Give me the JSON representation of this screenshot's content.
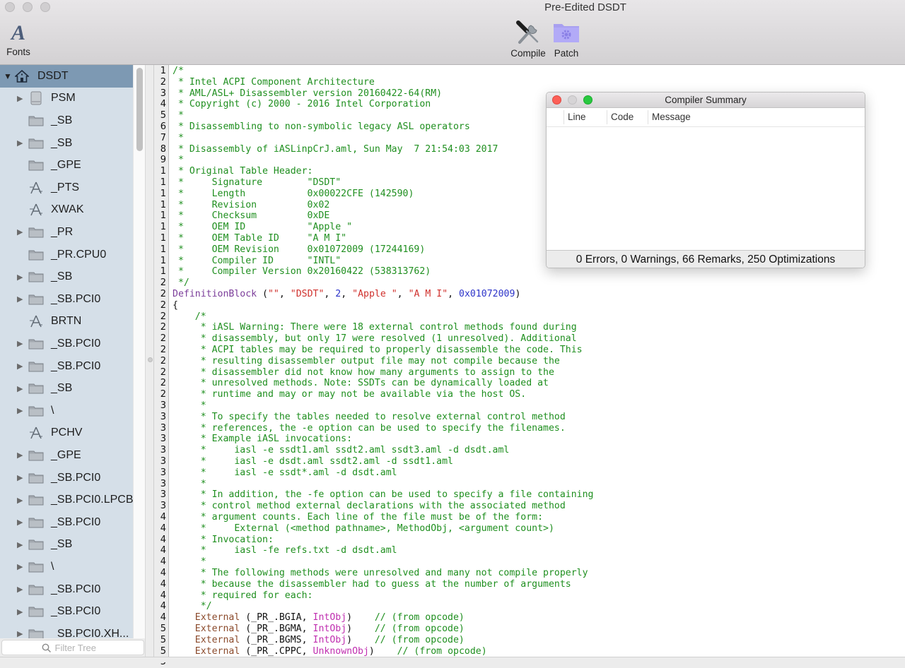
{
  "window": {
    "title": "Pre-Edited DSDT",
    "toolbar": {
      "fonts_label": "Fonts",
      "fonts_glyph": "A",
      "compile_label": "Compile",
      "patch_label": "Patch"
    }
  },
  "sidebar": {
    "root": {
      "label": "DSDT",
      "icon": "house-icon",
      "expanded": true
    },
    "items": [
      {
        "label": "PSM",
        "icon": "disk-icon",
        "expandable": true
      },
      {
        "label": "_SB",
        "icon": "folder-icon",
        "expandable": false
      },
      {
        "label": "_SB",
        "icon": "folder-icon",
        "expandable": true
      },
      {
        "label": "_GPE",
        "icon": "folder-icon",
        "expandable": false
      },
      {
        "label": "_PTS",
        "icon": "method-icon",
        "expandable": false
      },
      {
        "label": "XWAK",
        "icon": "method-icon",
        "expandable": false
      },
      {
        "label": "_PR",
        "icon": "folder-icon",
        "expandable": true
      },
      {
        "label": "_PR.CPU0",
        "icon": "folder-icon",
        "expandable": false
      },
      {
        "label": "_SB",
        "icon": "folder-icon",
        "expandable": true
      },
      {
        "label": "_SB.PCI0",
        "icon": "folder-icon",
        "expandable": true
      },
      {
        "label": "BRTN",
        "icon": "method-icon",
        "expandable": false
      },
      {
        "label": "_SB.PCI0",
        "icon": "folder-icon",
        "expandable": true
      },
      {
        "label": "_SB.PCI0",
        "icon": "folder-icon",
        "expandable": true
      },
      {
        "label": "_SB",
        "icon": "folder-icon",
        "expandable": true
      },
      {
        "label": "\\",
        "icon": "folder-icon",
        "expandable": true
      },
      {
        "label": "PCHV",
        "icon": "method-icon",
        "expandable": false
      },
      {
        "label": "_GPE",
        "icon": "folder-icon",
        "expandable": true
      },
      {
        "label": "_SB.PCI0",
        "icon": "folder-icon",
        "expandable": true
      },
      {
        "label": "_SB.PCI0.LPCB",
        "icon": "folder-icon",
        "expandable": true
      },
      {
        "label": "_SB.PCI0",
        "icon": "folder-icon",
        "expandable": true
      },
      {
        "label": "_SB",
        "icon": "folder-icon",
        "expandable": true
      },
      {
        "label": "\\",
        "icon": "folder-icon",
        "expandable": true
      },
      {
        "label": "_SB.PCI0",
        "icon": "folder-icon",
        "expandable": true
      },
      {
        "label": "_SB.PCI0",
        "icon": "folder-icon",
        "expandable": true
      },
      {
        "label": "_SB.PCI0.XH...",
        "icon": "folder-icon",
        "expandable": true
      }
    ],
    "filter": {
      "placeholder": "Filter Tree",
      "value": ""
    }
  },
  "editor": {
    "line_numbers": [
      "1",
      "2",
      "3",
      "4",
      "5",
      "6",
      "7",
      "8",
      "9",
      "1",
      "1",
      "1",
      "1",
      "1",
      "1",
      "1",
      "1",
      "1",
      "1",
      "2",
      "2",
      "2",
      "2",
      "2",
      "2",
      "2",
      "2",
      "2",
      "2",
      "2",
      "3",
      "3",
      "3",
      "3",
      "3",
      "3",
      "3",
      "3",
      "3",
      "3",
      "4",
      "4",
      "4",
      "4",
      "4",
      "4",
      "4",
      "4",
      "4",
      "4",
      "5",
      "5",
      "5",
      "5"
    ],
    "lines": [
      [
        {
          "t": "/*",
          "c": "com"
        }
      ],
      [
        {
          "t": " * Intel ACPI Component Architecture",
          "c": "com"
        }
      ],
      [
        {
          "t": " * AML/ASL+ Disassembler version 20160422-64(RM)",
          "c": "com"
        }
      ],
      [
        {
          "t": " * Copyright (c) 2000 - 2016 Intel Corporation",
          "c": "com"
        }
      ],
      [
        {
          "t": " *",
          "c": "com"
        }
      ],
      [
        {
          "t": " * Disassembling to non-symbolic legacy ASL operators",
          "c": "com"
        }
      ],
      [
        {
          "t": " *",
          "c": "com"
        }
      ],
      [
        {
          "t": " * Disassembly of iASLinpCrJ.aml, Sun May  7 21:54:03 2017",
          "c": "com"
        }
      ],
      [
        {
          "t": " *",
          "c": "com"
        }
      ],
      [
        {
          "t": " * Original Table Header:",
          "c": "com"
        }
      ],
      [
        {
          "t": " *     Signature        \"DSDT\"",
          "c": "com"
        }
      ],
      [
        {
          "t": " *     Length           0x00022CFE (142590)",
          "c": "com"
        }
      ],
      [
        {
          "t": " *     Revision         0x02",
          "c": "com"
        }
      ],
      [
        {
          "t": " *     Checksum         0xDE",
          "c": "com"
        }
      ],
      [
        {
          "t": " *     OEM ID           \"Apple \"",
          "c": "com"
        }
      ],
      [
        {
          "t": " *     OEM Table ID     \"A M I\"",
          "c": "com"
        }
      ],
      [
        {
          "t": " *     OEM Revision     0x01072009 (17244169)",
          "c": "com"
        }
      ],
      [
        {
          "t": " *     Compiler ID      \"INTL\"",
          "c": "com"
        }
      ],
      [
        {
          "t": " *     Compiler Version 0x20160422 (538313762)",
          "c": "com"
        }
      ],
      [
        {
          "t": " */",
          "c": "com"
        }
      ],
      [
        {
          "t": "DefinitionBlock",
          "c": "kw"
        },
        {
          "t": " (",
          "c": "plain"
        },
        {
          "t": "\"\"",
          "c": "str"
        },
        {
          "t": ", ",
          "c": "plain"
        },
        {
          "t": "\"DSDT\"",
          "c": "str"
        },
        {
          "t": ", ",
          "c": "plain"
        },
        {
          "t": "2",
          "c": "num"
        },
        {
          "t": ", ",
          "c": "plain"
        },
        {
          "t": "\"Apple \"",
          "c": "str"
        },
        {
          "t": ", ",
          "c": "plain"
        },
        {
          "t": "\"A M I\"",
          "c": "str"
        },
        {
          "t": ", ",
          "c": "plain"
        },
        {
          "t": "0x01072009",
          "c": "num"
        },
        {
          "t": ")",
          "c": "plain"
        }
      ],
      [
        {
          "t": "{",
          "c": "plain"
        }
      ],
      [
        {
          "t": "    /*",
          "c": "com"
        }
      ],
      [
        {
          "t": "     * iASL Warning: There were 18 external control methods found during",
          "c": "com"
        }
      ],
      [
        {
          "t": "     * disassembly, but only 17 were resolved (1 unresolved). Additional",
          "c": "com"
        }
      ],
      [
        {
          "t": "     * ACPI tables may be required to properly disassemble the code. This",
          "c": "com"
        }
      ],
      [
        {
          "t": "     * resulting disassembler output file may not compile because the",
          "c": "com"
        }
      ],
      [
        {
          "t": "     * disassembler did not know how many arguments to assign to the",
          "c": "com"
        }
      ],
      [
        {
          "t": "     * unresolved methods. Note: SSDTs can be dynamically loaded at",
          "c": "com"
        }
      ],
      [
        {
          "t": "     * runtime and may or may not be available via the host OS.",
          "c": "com"
        }
      ],
      [
        {
          "t": "     *",
          "c": "com"
        }
      ],
      [
        {
          "t": "     * To specify the tables needed to resolve external control method",
          "c": "com"
        }
      ],
      [
        {
          "t": "     * references, the -e option can be used to specify the filenames.",
          "c": "com"
        }
      ],
      [
        {
          "t": "     * Example iASL invocations:",
          "c": "com"
        }
      ],
      [
        {
          "t": "     *     iasl -e ssdt1.aml ssdt2.aml ssdt3.aml -d dsdt.aml",
          "c": "com"
        }
      ],
      [
        {
          "t": "     *     iasl -e dsdt.aml ssdt2.aml -d ssdt1.aml",
          "c": "com"
        }
      ],
      [
        {
          "t": "     *     iasl -e ssdt*.aml -d dsdt.aml",
          "c": "com"
        }
      ],
      [
        {
          "t": "     *",
          "c": "com"
        }
      ],
      [
        {
          "t": "     * In addition, the -fe option can be used to specify a file containing",
          "c": "com"
        }
      ],
      [
        {
          "t": "     * control method external declarations with the associated method",
          "c": "com"
        }
      ],
      [
        {
          "t": "     * argument counts. Each line of the file must be of the form:",
          "c": "com"
        }
      ],
      [
        {
          "t": "     *     External (<method pathname>, MethodObj, <argument count>)",
          "c": "com"
        }
      ],
      [
        {
          "t": "     * Invocation:",
          "c": "com"
        }
      ],
      [
        {
          "t": "     *     iasl -fe refs.txt -d dsdt.aml",
          "c": "com"
        }
      ],
      [
        {
          "t": "     *",
          "c": "com"
        }
      ],
      [
        {
          "t": "     * The following methods were unresolved and many not compile properly",
          "c": "com"
        }
      ],
      [
        {
          "t": "     * because the disassembler had to guess at the number of arguments",
          "c": "com"
        }
      ],
      [
        {
          "t": "     * required for each:",
          "c": "com"
        }
      ],
      [
        {
          "t": "     */",
          "c": "com"
        }
      ],
      [
        {
          "t": "    External",
          "c": "ext"
        },
        {
          "t": " (_PR_.BGIA, ",
          "c": "plain"
        },
        {
          "t": "IntObj",
          "c": "obj"
        },
        {
          "t": ")    ",
          "c": "plain"
        },
        {
          "t": "// (from opcode)",
          "c": "com"
        }
      ],
      [
        {
          "t": "    External",
          "c": "ext"
        },
        {
          "t": " (_PR_.BGMA, ",
          "c": "plain"
        },
        {
          "t": "IntObj",
          "c": "obj"
        },
        {
          "t": ")    ",
          "c": "plain"
        },
        {
          "t": "// (from opcode)",
          "c": "com"
        }
      ],
      [
        {
          "t": "    External",
          "c": "ext"
        },
        {
          "t": " (_PR_.BGMS, ",
          "c": "plain"
        },
        {
          "t": "IntObj",
          "c": "obj"
        },
        {
          "t": ")    ",
          "c": "plain"
        },
        {
          "t": "// (from opcode)",
          "c": "com"
        }
      ],
      [
        {
          "t": "    External",
          "c": "ext"
        },
        {
          "t": " (_PR_.CPPC, ",
          "c": "plain"
        },
        {
          "t": "UnknownObj",
          "c": "obj"
        },
        {
          "t": ")    ",
          "c": "plain"
        },
        {
          "t": "// (from opcode)",
          "c": "com"
        }
      ]
    ]
  },
  "compiler_summary": {
    "title": "Compiler Summary",
    "columns": [
      "Line",
      "Code",
      "Message"
    ],
    "rows": [],
    "status": "0 Errors, 0 Warnings, 66 Remarks, 250 Optimizations"
  },
  "colors": {
    "comment": "#1f8f1f",
    "keyword": "#7b3d9a",
    "string": "#d0312d",
    "number": "#2d34c9",
    "external": "#8b4a2b",
    "object_type": "#c02fb0",
    "sidebar_bg": "#d5dfe8",
    "sidebar_selected": "#7d99b3"
  }
}
